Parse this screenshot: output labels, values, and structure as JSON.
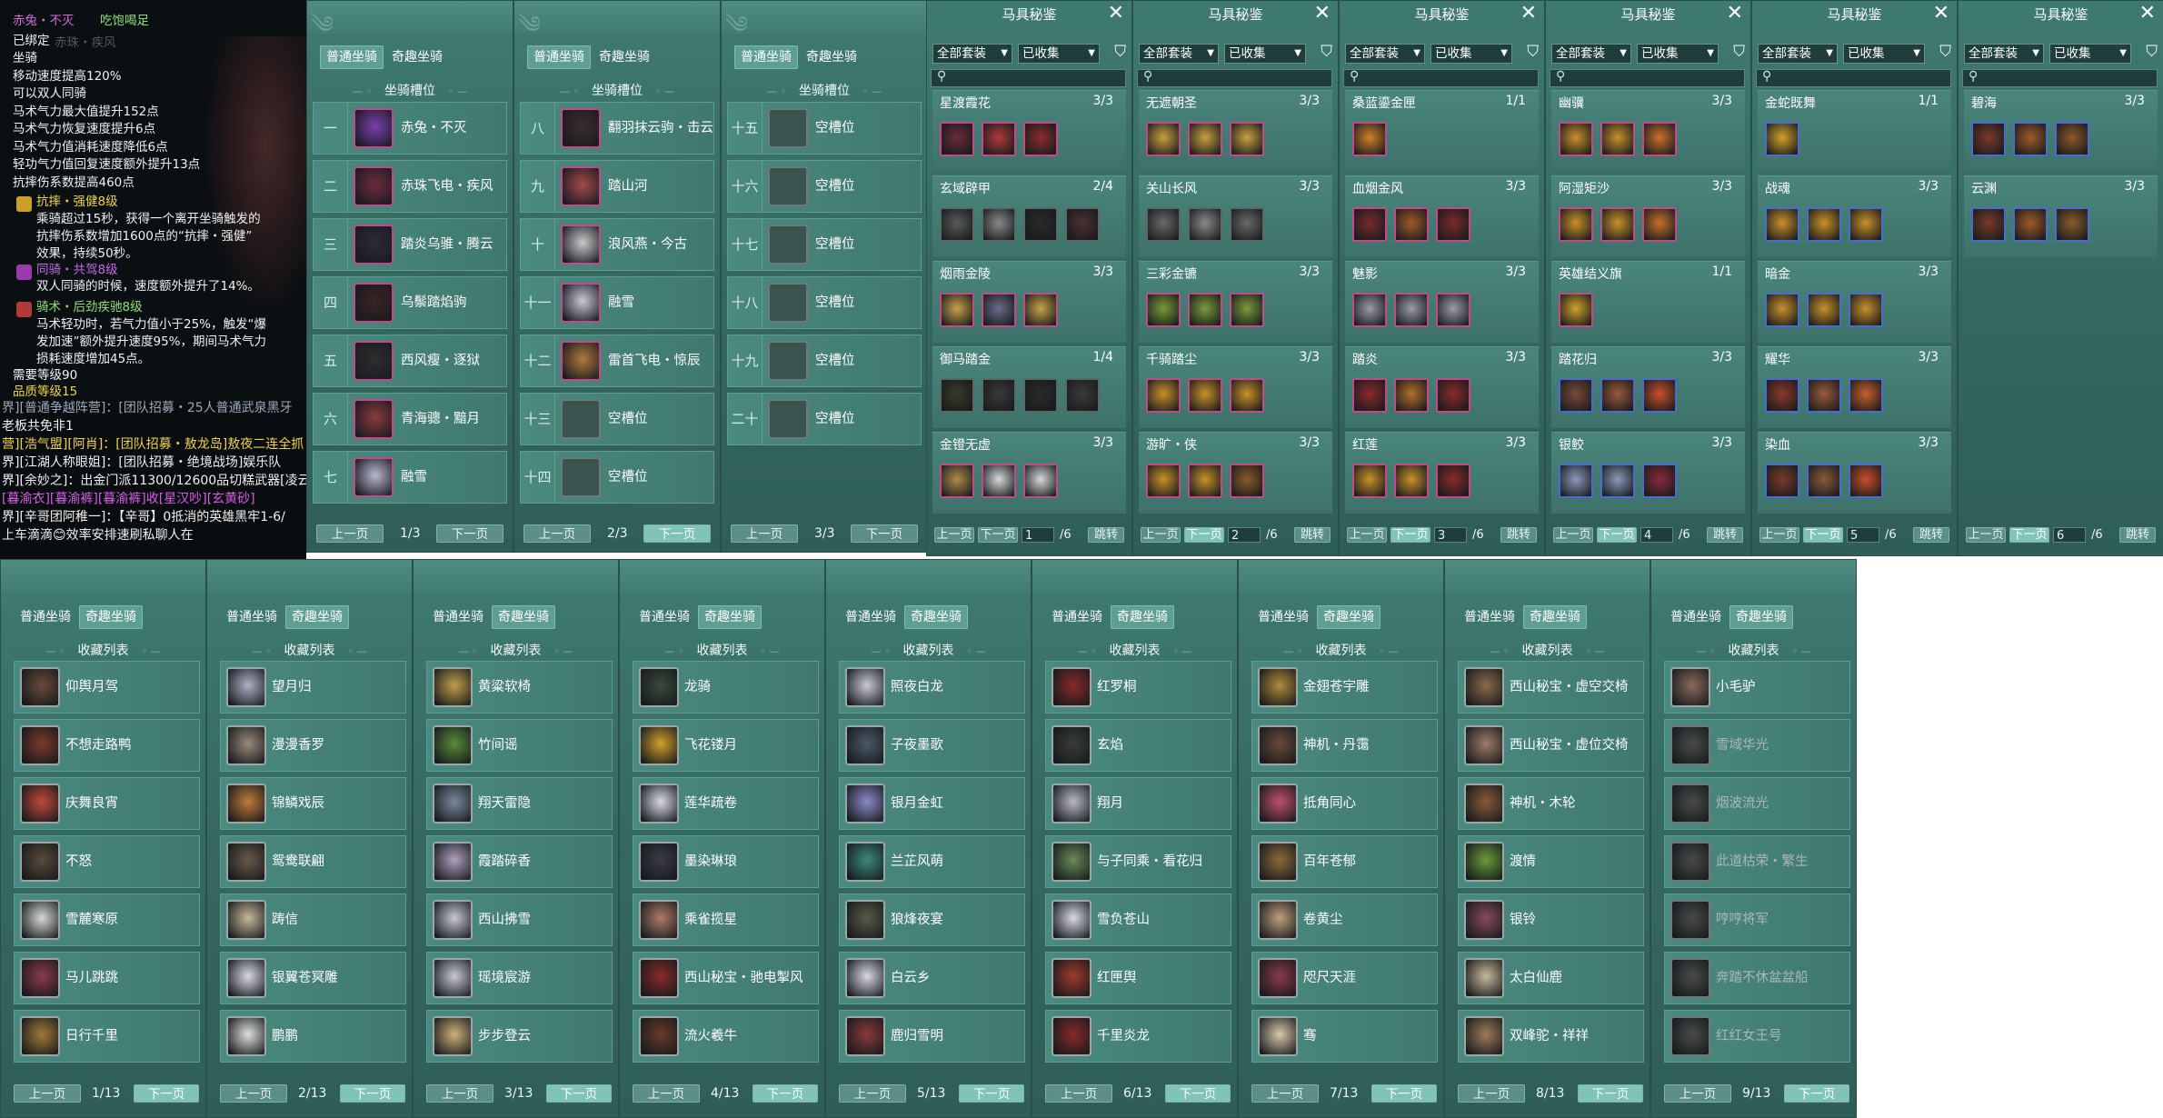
{
  "tooltip": {
    "title": "赤兔・不灭",
    "title_tag": "吃饱喝足",
    "lines": [
      "已绑定",
      "坐骑",
      "移动速度提高120%",
      "可以双人同骑",
      "马术气力最大值提升152点",
      "马术气力恢复速度提升6点",
      "马术气力值消耗速度降低6点",
      "轻功气力值回复速度额外提升13点",
      "抗摔伤系数提高460点"
    ],
    "ghost": "赤珠・疾风",
    "skills": [
      {
        "name": "抗摔・强健8级",
        "desc": [
          "乘骑超过15秒，获得一个离开坐骑触发的",
          "抗摔伤系数增加1600点的“抗摔・强健”",
          "效果，持续50秒。"
        ]
      },
      {
        "name": "同骑・共驾8级",
        "desc": [
          "双人同骑的时候，速度额外提升了14%。"
        ]
      },
      {
        "name": "骑术・后劲疾驰8级",
        "desc": [
          "马术轻功时，若气力值小于25%，触发“爆",
          "发加速”额外提升速度95%，期间马术气力",
          "损耗速度增加45点。"
        ]
      }
    ],
    "req_level": "需要等级90",
    "quality": "品质等级15"
  },
  "chat": {
    "lines": [
      "界][普通争越阵营]：[团队招募・25人普通武泉黑牙",
      "老板共免非1",
      "营][浩气盟][阿肖]：[团队招募・敖龙岛]敖夜二连全抓",
      "界][江湖人称眼姐]：[团队招募・绝境战场]娱乐队",
      "界][余妙之]：出金门派11300/12600品切糕武器[凌云",
      "[暮渝衣][暮渝裤][暮渝裤]收[星汉吵][玄黄砂]",
      "界][辛哥团阿稚一]：【辛哥】0抵消的英雄黑牢1-6/",
      "上车滴滴😊效率安排速刷私聊人在"
    ]
  },
  "colors": {
    "accent": "#5f9e93",
    "tooltip_gold": "#f0d34a",
    "tooltip_purple": "#c56ae6",
    "tooltip_green": "#8fe07a",
    "chat_purple": "#d55ee6"
  },
  "tab_normal": "普通坐骑",
  "tab_special": "奇趣坐骑",
  "list_header_slots": "坐骑槽位",
  "list_header_fav": "收藏列表",
  "prev": "上一页",
  "next": "下一页",
  "slot_panels": [
    {
      "page": "1/3",
      "rows": [
        {
          "num": "一",
          "name": "赤兔・不灭",
          "c": "#7a3fb0"
        },
        {
          "num": "二",
          "name": "赤珠飞电・疾风",
          "c": "#6b2b3c"
        },
        {
          "num": "三",
          "name": "踏炎乌骓・腾云",
          "c": "#2b2b34"
        },
        {
          "num": "四",
          "name": "乌鬃踏焰驹",
          "c": "#3a2323"
        },
        {
          "num": "五",
          "name": "西风瘦・逐狱",
          "c": "#2e2e2e"
        },
        {
          "num": "六",
          "name": "青海骢・黯月",
          "c": "#8a3b3b"
        },
        {
          "num": "七",
          "name": "融雪",
          "c": "#b8b8d0"
        }
      ]
    },
    {
      "page": "2/3",
      "rows": [
        {
          "num": "八",
          "name": "翻羽抹云驹・击云",
          "c": "#3c2c2c"
        },
        {
          "num": "九",
          "name": "踏山河",
          "c": "#a24a4a"
        },
        {
          "num": "十",
          "name": "浪风燕・今古",
          "c": "#c9c9c9"
        },
        {
          "num": "十一",
          "name": "融雪",
          "c": "#c8c8d8"
        },
        {
          "num": "十二",
          "name": "雷首飞电・惊辰",
          "c": "#b07a3a"
        },
        {
          "num": "十三",
          "name": "空槽位",
          "c": "",
          "empty": true
        },
        {
          "num": "十四",
          "name": "空槽位",
          "c": "",
          "empty": true
        }
      ]
    },
    {
      "page": "3/3",
      "rows": [
        {
          "num": "十五",
          "name": "空槽位",
          "empty": true
        },
        {
          "num": "十六",
          "name": "空槽位",
          "empty": true
        },
        {
          "num": "十七",
          "name": "空槽位",
          "empty": true
        },
        {
          "num": "十八",
          "name": "空槽位",
          "empty": true
        },
        {
          "num": "十九",
          "name": "空槽位",
          "empty": true
        },
        {
          "num": "二十",
          "name": "空槽位",
          "empty": true
        }
      ]
    }
  ],
  "gear_title": "马具秘鉴",
  "gear_filter_all": "全部套装",
  "gear_filter_owned": "已收集",
  "gear_jump": "跳转",
  "gear_total": "/6",
  "gear_panels": [
    {
      "page": "1",
      "sets": [
        {
          "name": "星渡霞花",
          "count": "3/3",
          "items": [
            "#6b2a3a",
            "#b03a3a",
            "#8a2d2d"
          ],
          "border": "pink"
        },
        {
          "name": "玄域辟甲",
          "count": "2/4",
          "items": [
            "#5a5a5a",
            "#8a8a8a",
            "#2a2a2a",
            "#4a3030"
          ],
          "border": "dk"
        },
        {
          "name": "烟雨金陵",
          "count": "3/3",
          "items": [
            "#c9a04a",
            "#6b6b8a",
            "#c9a04a"
          ],
          "border": "pink"
        },
        {
          "name": "御马踏金",
          "count": "1/4",
          "items": [
            "#3a3a2a",
            "#3a3a3a",
            "#2a2a2a",
            "#3a3a3a"
          ],
          "border": "dk"
        },
        {
          "name": "金镫无虚",
          "count": "3/3",
          "items": [
            "#b08a4a",
            "#d8d8d8",
            "#d8d8d8"
          ],
          "border": "pink"
        }
      ]
    },
    {
      "page": "2",
      "sets": [
        {
          "name": "无遮朝圣",
          "count": "3/3",
          "items": [
            "#c9a040",
            "#c9a040",
            "#c9a040"
          ],
          "border": "pink"
        },
        {
          "name": "关山长风",
          "count": "3/3",
          "items": [
            "#6a6a6a",
            "#8a8a8a",
            "#6a6a6a"
          ],
          "border": "dk"
        },
        {
          "name": "三彩金镳",
          "count": "3/3",
          "items": [
            "#7a9a3a",
            "#7a9a3a",
            "#7a9a3a"
          ],
          "border": "pink"
        },
        {
          "name": "千骑踏尘",
          "count": "3/3",
          "items": [
            "#c9902a",
            "#c9902a",
            "#c9902a"
          ],
          "border": "pink"
        },
        {
          "name": "游旷・侠",
          "count": "3/3",
          "items": [
            "#c9902a",
            "#c9902a",
            "#8a5a2a"
          ],
          "border": "pink"
        }
      ]
    },
    {
      "page": "3",
      "sets": [
        {
          "name": "桑蓝鎏金匣",
          "count": "1/1",
          "items": [
            "#d0802a"
          ],
          "border": "pink"
        },
        {
          "name": "血烟金风",
          "count": "3/3",
          "items": [
            "#7a2a2a",
            "#a05a2a",
            "#7a2a2a"
          ],
          "border": "pink"
        },
        {
          "name": "魅影",
          "count": "3/3",
          "items": [
            "#9a9aaa",
            "#9a9aaa",
            "#9a9aaa"
          ],
          "border": "pink"
        },
        {
          "name": "踏炎",
          "count": "3/3",
          "items": [
            "#8a2a2a",
            "#b0702a",
            "#8a2a2a"
          ],
          "border": "pink"
        },
        {
          "name": "红莲",
          "count": "3/3",
          "items": [
            "#c9902a",
            "#c9902a",
            "#8a2a2a"
          ],
          "border": "pink"
        }
      ]
    },
    {
      "page": "4",
      "sets": [
        {
          "name": "幽骥",
          "count": "3/3",
          "items": [
            "#c9902a",
            "#c9902a",
            "#c9702a"
          ],
          "border": "pink"
        },
        {
          "name": "阿湿矩沙",
          "count": "3/3",
          "items": [
            "#c9902a",
            "#c9902a",
            "#c9702a"
          ],
          "border": "pink"
        },
        {
          "name": "英雄结义旗",
          "count": "1/1",
          "items": [
            "#d0a02a"
          ],
          "border": "pink"
        },
        {
          "name": "踏花归",
          "count": "3/3",
          "items": [
            "#7a4a3a",
            "#9a5a3a",
            "#c9502a"
          ],
          "border": "bl"
        },
        {
          "name": "银鲛",
          "count": "3/3",
          "items": [
            "#8a9aba",
            "#8a9aba",
            "#8a2a3a"
          ],
          "border": "bl"
        }
      ]
    },
    {
      "page": "5",
      "sets": [
        {
          "name": "金蛇既舞",
          "count": "1/1",
          "items": [
            "#d0a02a"
          ],
          "border": "bl"
        },
        {
          "name": "战魂",
          "count": "3/3",
          "items": [
            "#c9902a",
            "#c9902a",
            "#c9902a"
          ],
          "border": "bl"
        },
        {
          "name": "暗金",
          "count": "3/3",
          "items": [
            "#c9902a",
            "#c9902a",
            "#c9902a"
          ],
          "border": "bl"
        },
        {
          "name": "耀华",
          "count": "3/3",
          "items": [
            "#8a3a2a",
            "#9a5a3a",
            "#c9602a"
          ],
          "border": "bl"
        },
        {
          "name": "染血",
          "count": "3/3",
          "items": [
            "#7a3a2a",
            "#8a5a3a",
            "#c9502a"
          ],
          "border": "bl"
        }
      ]
    },
    {
      "page": "6",
      "sets": [
        {
          "name": "碧海",
          "count": "3/3",
          "items": [
            "#7a3a2a",
            "#a05a2a",
            "#8a5a2a"
          ],
          "border": "bl"
        },
        {
          "name": "云渊",
          "count": "3/3",
          "items": [
            "#7a3a2a",
            "#a05a2a",
            "#8a5a2a"
          ],
          "border": "bl"
        }
      ]
    }
  ],
  "fav_panels": [
    {
      "page": "1/13",
      "items": [
        [
          "仰舆月驾",
          "#6a4a3a"
        ],
        [
          "不想走路鸭",
          "#7a3a2a"
        ],
        [
          "庆舞良宵",
          "#c04a3a"
        ],
        [
          "不怒",
          "#5a4a3a"
        ],
        [
          "雪麓寒原",
          "#d8d8d8"
        ],
        [
          "马儿跳跳",
          "#8a3a4a"
        ],
        [
          "日行千里",
          "#a07a3a"
        ]
      ]
    },
    {
      "page": "2/13",
      "items": [
        [
          "望月归",
          "#b0b0c8"
        ],
        [
          "漫漫香罗",
          "#9a8a7a"
        ],
        [
          "锦鳞戏辰",
          "#c07a3a"
        ],
        [
          "鸳鸯联翩",
          "#6a5a4a"
        ],
        [
          "踌信",
          "#c8b89a"
        ],
        [
          "银翼苍冥雕",
          "#d8d8e8"
        ],
        [
          "鹏鹏",
          "#e0e0e0"
        ]
      ]
    },
    {
      "page": "3/13",
      "items": [
        [
          "黄粱软椅",
          "#c0a04a"
        ],
        [
          "竹间谣",
          "#5a8a3a"
        ],
        [
          "翔天雷隐",
          "#7a8aa0"
        ],
        [
          "霞踏碎香",
          "#b0a0c0"
        ],
        [
          "西山拂雪",
          "#c8c8d8"
        ],
        [
          "瑶境宸游",
          "#c8c8d8"
        ],
        [
          "步步登云",
          "#d0b07a"
        ]
      ]
    },
    {
      "page": "4/13",
      "items": [
        [
          "龙骑",
          "#3a4a3a"
        ],
        [
          "飞花镂月",
          "#d0a02a"
        ],
        [
          "莲华疏卷",
          "#d8d8e8"
        ],
        [
          "墨染琳琅",
          "#3a3a4a"
        ],
        [
          "乘雀揽星",
          "#b07a6a"
        ],
        [
          "西山秘宝・驰电掣风",
          "#8a2a2a"
        ],
        [
          "流火羲牛",
          "#6a3a2a"
        ]
      ]
    },
    {
      "page": "5/13",
      "items": [
        [
          "照夜白龙",
          "#c8c8d8"
        ],
        [
          "子夜墨歌",
          "#4a5a6a"
        ],
        [
          "银月金虹",
          "#8a8ac8"
        ],
        [
          "兰芷风萌",
          "#3a8a7a"
        ],
        [
          "狼烽夜宴",
          "#5a5a4a"
        ],
        [
          "白云乡",
          "#d8d8e8"
        ],
        [
          "鹿归雪明",
          "#8a3a3a"
        ]
      ]
    },
    {
      "page": "6/13",
      "items": [
        [
          "红罗桐",
          "#8a2a2a"
        ],
        [
          "玄焰",
          "#3a3a3a"
        ],
        [
          "翔月",
          "#b8b8c8"
        ],
        [
          "与子同乘・看花归",
          "#6a8a5a"
        ],
        [
          "雪负苍山",
          "#d8d8e8"
        ],
        [
          "红匣舆",
          "#a03a2a"
        ],
        [
          "千里炎龙",
          "#8a2a2a"
        ]
      ]
    },
    {
      "page": "7/13",
      "items": [
        [
          "金翅苍宇雕",
          "#b08a3a"
        ],
        [
          "神机・丹霭",
          "#6a4a3a"
        ],
        [
          "抵角同心",
          "#c0506a"
        ],
        [
          "百年苍郁",
          "#8a6a3a"
        ],
        [
          "卷黄尘",
          "#c0a07a"
        ],
        [
          "咫尺天涯",
          "#8a3a4a"
        ],
        [
          "骞",
          "#d8c8a8"
        ]
      ]
    },
    {
      "page": "8/13",
      "items": [
        [
          "西山秘宝・虚空交椅",
          "#8a6a4a"
        ],
        [
          "西山秘宝・虚位交椅",
          "#a07a6a"
        ],
        [
          "神机・木轮",
          "#8a5a3a"
        ],
        [
          "渡情",
          "#6a9a3a"
        ],
        [
          "银铃",
          "#8a4a5a"
        ],
        [
          "太白仙鹿",
          "#c8b89a"
        ],
        [
          "双峰驼・祥祥",
          "#a07a5a"
        ]
      ]
    },
    {
      "page": "9/13",
      "items": [
        [
          "小毛驴",
          "#8a6a5a"
        ],
        [
          "雪域华光",
          "#4a4a4a",
          true
        ],
        [
          "烟波流光",
          "#4a4a4a",
          true
        ],
        [
          "此道枯荣・繁生",
          "#4a4a4a",
          true
        ],
        [
          "哼哼将军",
          "#4a4a4a",
          true
        ],
        [
          "奔踏不休盆盆船",
          "#4a4a4a",
          true
        ],
        [
          "红红女王号",
          "#4a4a4a",
          true
        ]
      ]
    }
  ]
}
